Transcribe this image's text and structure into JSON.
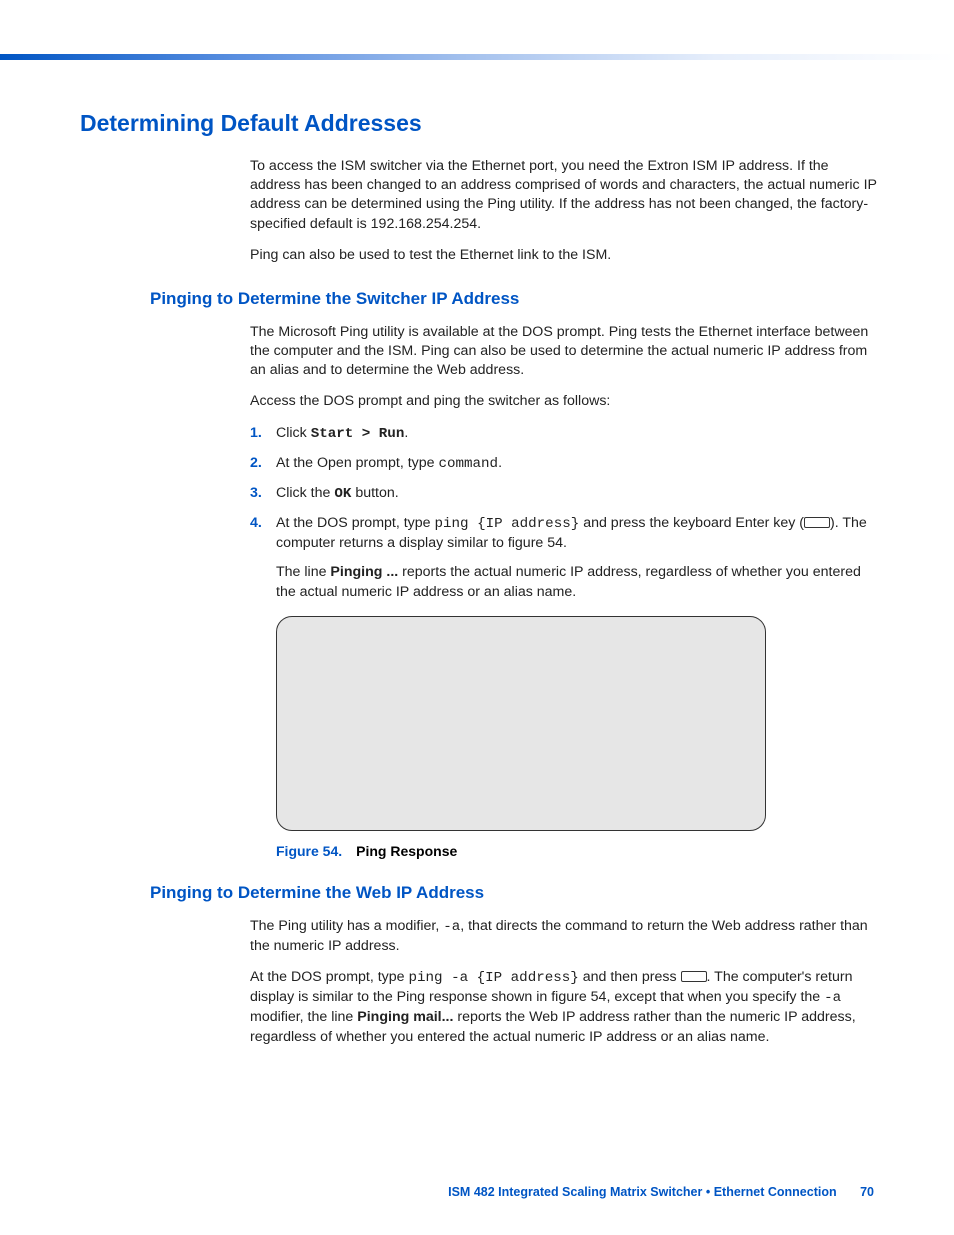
{
  "headings": {
    "main": "Determining Default Addresses",
    "sub1": "Pinging to Determine the Switcher IP Address",
    "sub2": "Pinging to Determine the Web IP Address"
  },
  "intro": {
    "p1": "To access the ISM switcher via the Ethernet port, you need the Extron ISM IP address. If the address has been changed to an address comprised of words and characters, the actual numeric IP address can be determined using the Ping utility. If the address has not been changed, the factory-specified default is 192.168.254.254.",
    "p2": "Ping can also be used to test the Ethernet link to the ISM."
  },
  "section1": {
    "p1": "The Microsoft Ping utility is available at the DOS prompt. Ping tests the Ethernet interface between the computer and the ISM. Ping can also be used to determine the actual numeric IP address from an alias and to determine the Web address.",
    "p2": "Access the DOS prompt and ping the switcher as follows:",
    "steps": {
      "s1": {
        "num": "1.",
        "pre": "Click ",
        "code": "Start > Run",
        "post": "."
      },
      "s2": {
        "num": "2.",
        "pre": "At the Open prompt, type ",
        "code": "command",
        "post": "."
      },
      "s3": {
        "num": "3.",
        "pre": "Click the ",
        "code": "OK",
        "post": " button."
      },
      "s4": {
        "num": "4.",
        "pre": "At the DOS prompt, type ",
        "code": "ping {IP address}",
        "mid": " and press the keyboard Enter key (",
        "post": "). The computer returns a display similar to figure 54."
      }
    },
    "note_pre": "The line ",
    "note_bold": "Pinging ...",
    "note_post": " reports the actual numeric IP address, regardless of whether you entered the actual numeric IP address or an alias name.",
    "figure": {
      "label": "Figure 54.",
      "title": "Ping Response"
    }
  },
  "section2": {
    "p1_pre": "The Ping utility has a modifier, ",
    "p1_code": "-a",
    "p1_post": ", that directs the command to return the Web address rather than the numeric IP address.",
    "p2_pre": "At the DOS prompt, type ",
    "p2_code1": "ping -a {IP address}",
    "p2_mid1": " and then press ",
    "p2_mid2": ". The computer's return display is similar to the Ping response shown in figure 54, except that when you specify the ",
    "p2_code2": "-a",
    "p2_mid3": " modifier, the line ",
    "p2_bold": "Pinging mail...",
    "p2_post": " reports the Web IP address rather than the numeric IP address, regardless of whether you entered the actual numeric IP address or an alias name."
  },
  "footer": {
    "doc": "ISM 482 Integrated Scaling Matrix Switcher • Ethernet Connection",
    "page": "70"
  }
}
